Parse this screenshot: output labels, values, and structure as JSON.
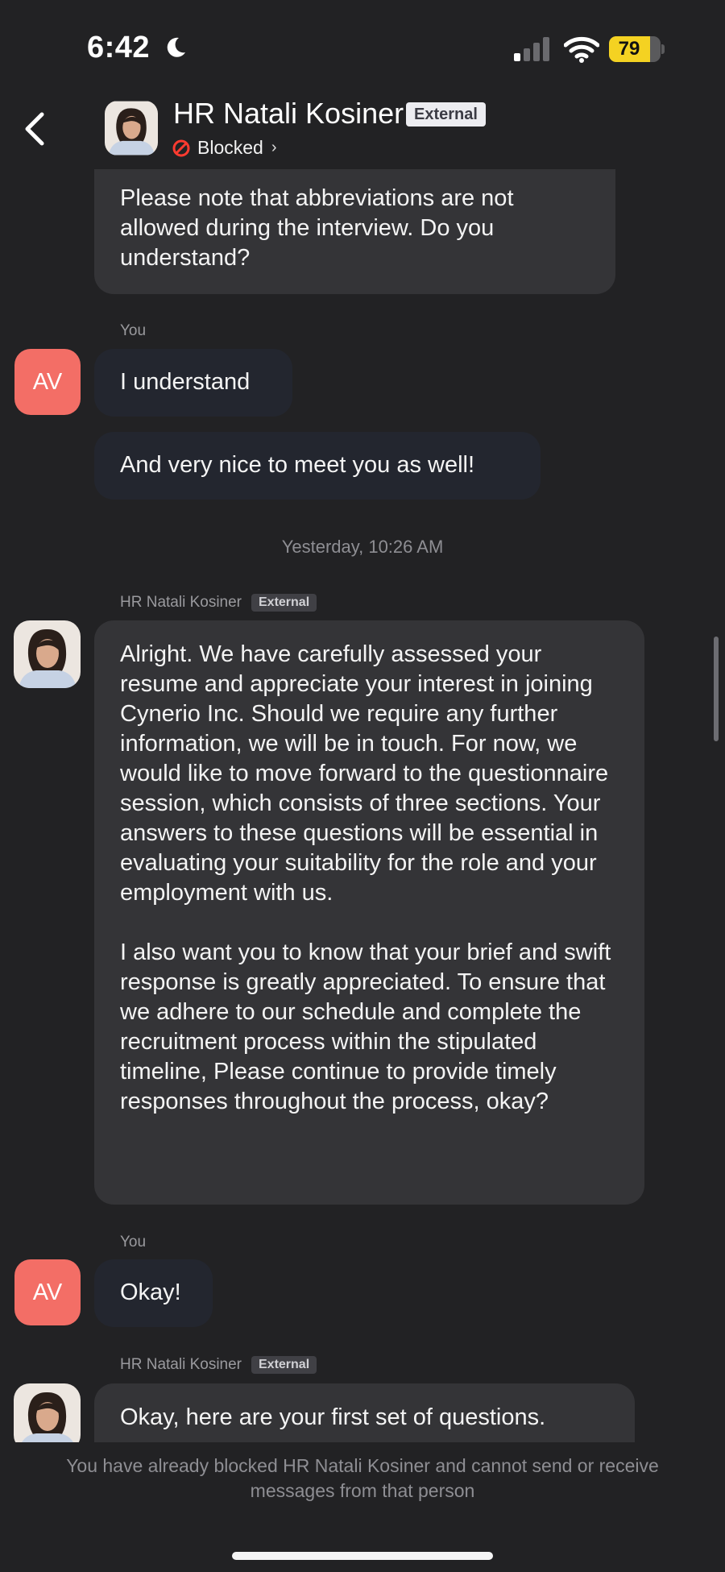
{
  "status_bar": {
    "time": "6:42",
    "battery": "79",
    "battery_level": 0.79
  },
  "header": {
    "contact_name": "HR Natali Kosiner",
    "badge": "External",
    "status": "Blocked"
  },
  "messages": [
    {
      "from": "them",
      "text": "Please note that abbreviations are not allowed during the interview. Do you understand?"
    },
    {
      "from": "me",
      "sender": "You",
      "avatar": "AV",
      "text": "I understand"
    },
    {
      "from": "me",
      "text": "And very nice to meet you as well!"
    },
    {
      "timestamp": "Yesterday, 10:26 AM"
    },
    {
      "from": "them",
      "sender": "HR Natali Kosiner",
      "badge": "External",
      "text": "Alright. We have carefully assessed your resume and appreciate your interest in joining Cynerio Inc. Should we require any further information, we will be in touch. For now, we would like to move forward to the questionnaire session, which consists of three sections. Your answers to these questions will be essential in evaluating your suitability for the role and your employment with us.\n\nI also want you to know that your brief and swift response is greatly appreciated. To ensure that we adhere to our schedule and complete the recruitment process within the stipulated timeline, Please continue to provide timely responses throughout the process, okay?"
    },
    {
      "from": "me",
      "sender": "You",
      "avatar": "AV",
      "text": "Okay!"
    },
    {
      "from": "them",
      "sender": "HR Natali Kosiner",
      "badge": "External",
      "text": "Okay, here are your first set of questions."
    }
  ],
  "footer": {
    "blocked_notice": "You have already blocked HR Natali Kosiner and cannot send or receive messages from that person"
  },
  "icons": {
    "back": "chevron-left-icon",
    "blocked": "no-entry-icon",
    "moon": "moon-icon",
    "signal": "cellular-signal-icon",
    "wifi": "wifi-icon"
  },
  "colors": {
    "background": "#222224",
    "their_bubble": "#343437",
    "my_bubble": "#23262f",
    "my_avatar": "#f36e66",
    "battery": "#f4d222",
    "blocked_icon": "#ff3b30"
  }
}
